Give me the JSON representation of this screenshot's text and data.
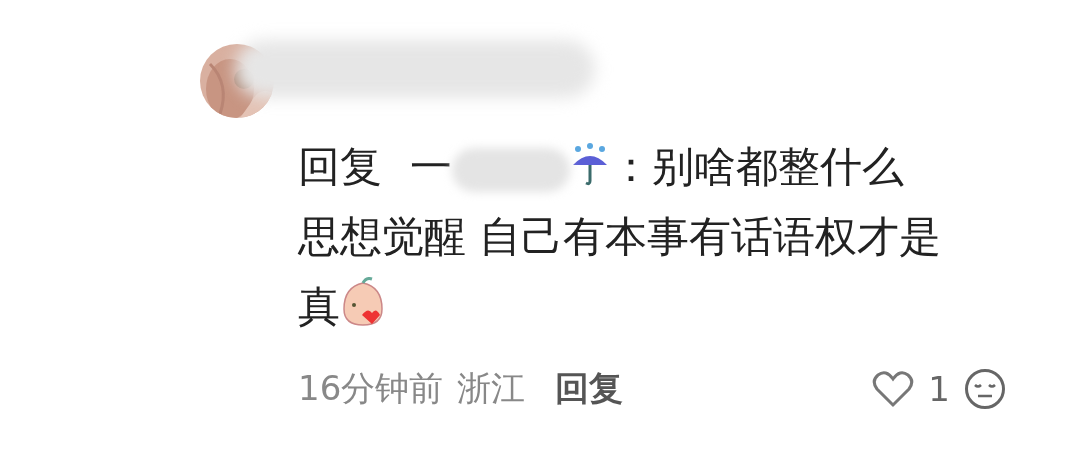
{
  "comment": {
    "reply_label": "回复",
    "mention": "一",
    "mention_end": "：",
    "text_lines": [
      "别啥都整什么",
      "思想觉醒 自己有本事有话语权才是",
      "真"
    ],
    "time": "16分钟前",
    "region": "浙江",
    "reply_button": "回复",
    "liked": false,
    "like_count": "1"
  }
}
